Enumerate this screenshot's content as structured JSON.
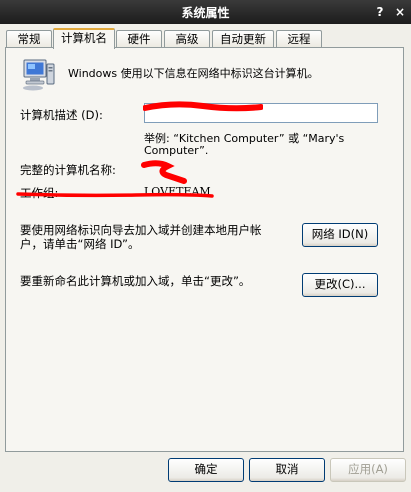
{
  "window": {
    "title": "系统属性",
    "help_glyph": "?",
    "close_glyph": "×"
  },
  "tabs": [
    {
      "label": "常规"
    },
    {
      "label": "计算机名"
    },
    {
      "label": "硬件"
    },
    {
      "label": "高级"
    },
    {
      "label": "自动更新"
    },
    {
      "label": "远程"
    }
  ],
  "panel": {
    "intro": "Windows 使用以下信息在网络中标识这台计算机。",
    "description_label": "计算机描述 (D):",
    "description_value": "",
    "example_line1": "举例: “Kitchen Computer” 或 “Mary's",
    "example_line2": "Computer”.",
    "full_name_label": "完整的计算机名称:",
    "workgroup_label": "工作组:",
    "workgroup_value": "LOVETEAM",
    "network_text_line1": "要使用网络标识向导去加入域并创建本地用户帐",
    "network_text_line2": "户，请单击“网络 ID”。",
    "network_id_button": "网络 ID(N)",
    "rename_text": "要重新命名此计算机或加入域，单击“更改”。",
    "change_button": "更改(C)..."
  },
  "footer": {
    "ok_button": "确定",
    "cancel_button": "取消",
    "apply_button": "应用(A)"
  },
  "colors": {
    "accent_tab": "#e1a83b",
    "redaction": "#ff0000",
    "titlebar": "#1c1c1c"
  }
}
